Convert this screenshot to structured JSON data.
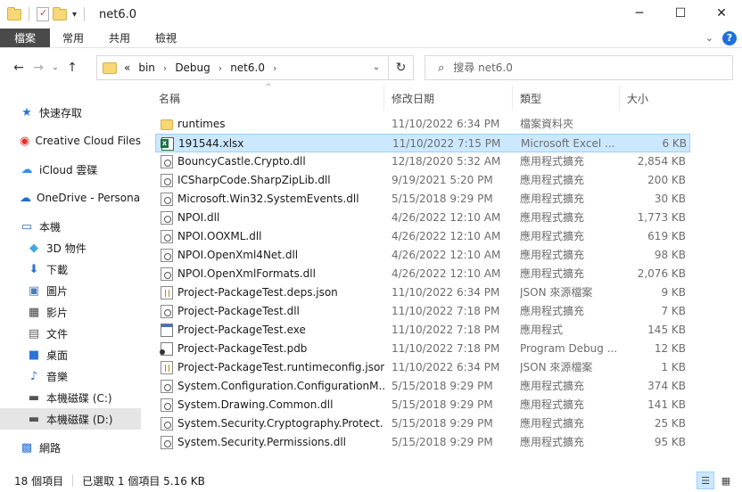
{
  "window": {
    "title": "net6.0",
    "minimize": "─",
    "maximize": "☐",
    "close": "✕"
  },
  "ribbon": {
    "file": "檔案",
    "home": "常用",
    "share": "共用",
    "view": "檢視",
    "collapse": "⌄",
    "help": "?"
  },
  "nav": {
    "back": "←",
    "forward": "→",
    "recent": "⌄",
    "up": "↑"
  },
  "address": {
    "prefix": "«",
    "crumbs": [
      "bin",
      "Debug",
      "net6.0"
    ],
    "sep": "›",
    "dropdown": "⌄",
    "refresh": "↻"
  },
  "search": {
    "placeholder": "搜尋 net6.0",
    "value": ""
  },
  "sidebar": {
    "items": [
      {
        "label": "快速存取",
        "icon": "star-icon",
        "glyph": "★",
        "color": "#2b73d8"
      },
      {
        "label": "Creative Cloud Files",
        "icon": "creative-cloud-icon",
        "glyph": "◉",
        "color": "#e0322b"
      },
      {
        "label": "iCloud 雲碟",
        "icon": "icloud-icon",
        "glyph": "☁",
        "color": "#3a8ee6"
      },
      {
        "label": "OneDrive - Personal",
        "icon": "onedrive-icon",
        "glyph": "☁",
        "color": "#1f6fc5"
      },
      {
        "label": "本機",
        "icon": "computer-icon",
        "glyph": "▭",
        "color": "#2e6fbf"
      },
      {
        "label": "3D 物件",
        "icon": "cube-icon",
        "glyph": "◆",
        "color": "#3fa9e0"
      },
      {
        "label": "下載",
        "icon": "download-icon",
        "glyph": "⬇",
        "color": "#2b73d8"
      },
      {
        "label": "圖片",
        "icon": "pictures-icon",
        "glyph": "▣",
        "color": "#4a7db8"
      },
      {
        "label": "影片",
        "icon": "videos-icon",
        "glyph": "▦",
        "color": "#444444"
      },
      {
        "label": "文件",
        "icon": "documents-icon",
        "glyph": "▤",
        "color": "#666666"
      },
      {
        "label": "桌面",
        "icon": "desktop-icon",
        "glyph": "■",
        "color": "#2b73d8"
      },
      {
        "label": "音樂",
        "icon": "music-icon",
        "glyph": "♪",
        "color": "#2b73d8"
      },
      {
        "label": "本機磁碟 (C:)",
        "icon": "drive-c-icon",
        "glyph": "▬",
        "color": "#555555"
      },
      {
        "label": "本機磁碟 (D:)",
        "icon": "drive-d-icon",
        "glyph": "▬",
        "color": "#555555"
      },
      {
        "label": "網路",
        "icon": "network-icon",
        "glyph": "▩",
        "color": "#2b73d8"
      }
    ]
  },
  "columns": {
    "name": "名稱",
    "date": "修改日期",
    "type": "類型",
    "size": "大小",
    "sort": "^"
  },
  "files": [
    {
      "name": "runtimes",
      "date": "11/10/2022 6:34 PM",
      "type": "檔案資料夾",
      "size": "",
      "icon": "folder"
    },
    {
      "name": "191544.xlsx",
      "date": "11/10/2022 7:15 PM",
      "type": "Microsoft Excel ...",
      "size": "6 KB",
      "icon": "xlsx"
    },
    {
      "name": "BouncyCastle.Crypto.dll",
      "date": "12/18/2020 5:32 AM",
      "type": "應用程式擴充",
      "size": "2,854 KB",
      "icon": "dll"
    },
    {
      "name": "ICSharpCode.SharpZipLib.dll",
      "date": "9/19/2021 5:20 PM",
      "type": "應用程式擴充",
      "size": "200 KB",
      "icon": "dll"
    },
    {
      "name": "Microsoft.Win32.SystemEvents.dll",
      "date": "5/15/2018 9:29 PM",
      "type": "應用程式擴充",
      "size": "30 KB",
      "icon": "dll"
    },
    {
      "name": "NPOI.dll",
      "date": "4/26/2022 12:10 AM",
      "type": "應用程式擴充",
      "size": "1,773 KB",
      "icon": "dll"
    },
    {
      "name": "NPOI.OOXML.dll",
      "date": "4/26/2022 12:10 AM",
      "type": "應用程式擴充",
      "size": "619 KB",
      "icon": "dll"
    },
    {
      "name": "NPOI.OpenXml4Net.dll",
      "date": "4/26/2022 12:10 AM",
      "type": "應用程式擴充",
      "size": "98 KB",
      "icon": "dll"
    },
    {
      "name": "NPOI.OpenXmlFormats.dll",
      "date": "4/26/2022 12:10 AM",
      "type": "應用程式擴充",
      "size": "2,076 KB",
      "icon": "dll"
    },
    {
      "name": "Project-PackageTest.deps.json",
      "date": "11/10/2022 6:34 PM",
      "type": "JSON 來源檔案",
      "size": "9 KB",
      "icon": "json"
    },
    {
      "name": "Project-PackageTest.dll",
      "date": "11/10/2022 7:18 PM",
      "type": "應用程式擴充",
      "size": "7 KB",
      "icon": "dll"
    },
    {
      "name": "Project-PackageTest.exe",
      "date": "11/10/2022 7:18 PM",
      "type": "應用程式",
      "size": "145 KB",
      "icon": "exe"
    },
    {
      "name": "Project-PackageTest.pdb",
      "date": "11/10/2022 7:18 PM",
      "type": "Program Debug ...",
      "size": "12 KB",
      "icon": "pdb"
    },
    {
      "name": "Project-PackageTest.runtimeconfig.json",
      "date": "11/10/2022 6:34 PM",
      "type": "JSON 來源檔案",
      "size": "1 KB",
      "icon": "json"
    },
    {
      "name": "System.Configuration.ConfigurationM...",
      "date": "5/15/2018 9:29 PM",
      "type": "應用程式擴充",
      "size": "374 KB",
      "icon": "dll"
    },
    {
      "name": "System.Drawing.Common.dll",
      "date": "5/15/2018 9:29 PM",
      "type": "應用程式擴充",
      "size": "141 KB",
      "icon": "dll"
    },
    {
      "name": "System.Security.Cryptography.Protect...",
      "date": "5/15/2018 9:29 PM",
      "type": "應用程式擴充",
      "size": "25 KB",
      "icon": "dll"
    },
    {
      "name": "System.Security.Permissions.dll",
      "date": "5/15/2018 9:29 PM",
      "type": "應用程式擴充",
      "size": "95 KB",
      "icon": "dll"
    }
  ],
  "selected_file": "191544.xlsx",
  "selected_sidebar": "本機磁碟 (D:)",
  "status": {
    "count": "18 個項目",
    "selection": "已選取 1 個項目  5.16 KB"
  },
  "views": {
    "details": "☰",
    "tiles": "▦"
  }
}
